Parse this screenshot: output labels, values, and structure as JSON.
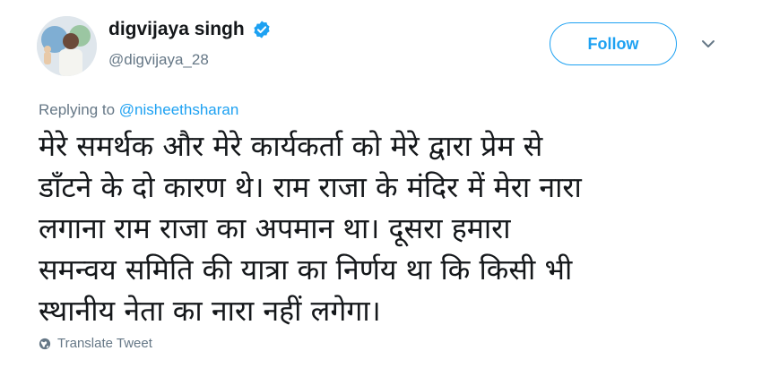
{
  "author": {
    "display_name": "digvijaya singh",
    "handle": "@digvijaya_28",
    "verified_icon": "verified-badge-icon"
  },
  "actions": {
    "follow_label": "Follow",
    "more_icon": "chevron-down-icon"
  },
  "reply": {
    "prefix": "Replying to",
    "mention": "@nisheethsharan"
  },
  "tweet": {
    "lines": [
      "मेरे समर्थक और मेरे कार्यकर्ता को मेरे द्वारा प्रेम से",
      "डाँटने के दो कारण थे। राम राजा के मंदिर में मेरा नारा",
      "लगाना राम राजा का अपमान था। दूसरा हमारा",
      "समन्वय समिति की यात्रा का निर्णय था कि किसी भी",
      "स्थानीय नेता का नारा नहीं लगेगा।"
    ]
  },
  "translate": {
    "label": "Translate Tweet",
    "icon": "globe-icon"
  },
  "colors": {
    "accent": "#1da1f2",
    "secondary_text": "#657786",
    "primary_text": "#14171a"
  }
}
